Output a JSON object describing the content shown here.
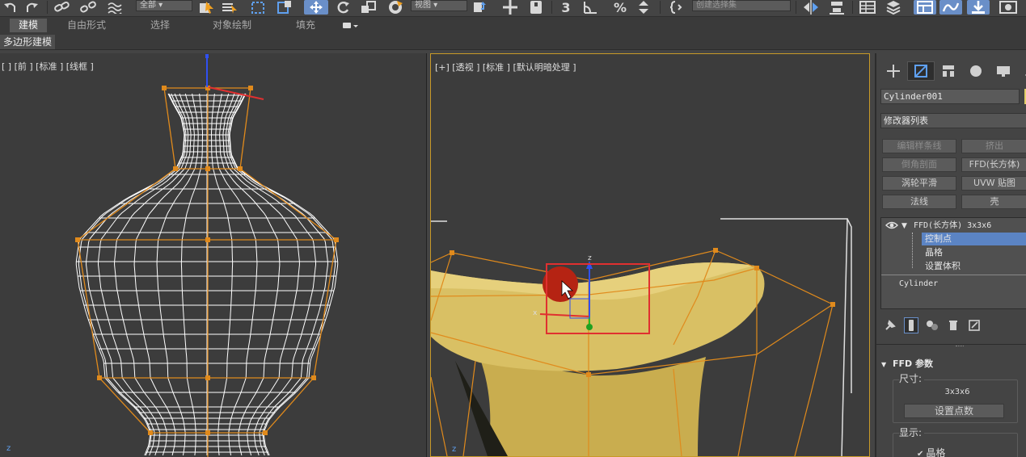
{
  "toolbar": {
    "filter_dropdown": "全部",
    "coord_dropdown": "视图",
    "selection_set_placeholder": "创建选择集",
    "icons": [
      "undo-icon",
      "redo-icon",
      "link-icon",
      "unlink-icon",
      "bind-space-warp-icon",
      "select-object-icon",
      "select-by-name-icon",
      "rect-region-icon",
      "window-crossing-icon",
      "move-icon",
      "rotate-icon",
      "scale-icon",
      "placement-icon",
      "pivot-icon",
      "snap-3d-icon",
      "angle-snap-icon",
      "percent-snap-icon",
      "spinner-snap-icon",
      "edit-named-selection-icon",
      "mirror-icon",
      "align-icon",
      "layer-explorer-icon",
      "toggle-ribbon-icon",
      "graph-editor-icon",
      "material-editor-icon",
      "render-setup-icon",
      "render-frame-icon"
    ]
  },
  "ribbon": {
    "tabs": [
      "建模",
      "自由形式",
      "选择",
      "对象绘制",
      "填充"
    ],
    "active_tab": "建模",
    "sub_tab": "多边形建模"
  },
  "viewports": {
    "left_label": "[ ] [前 ] [标准 ] [线框 ]",
    "right_label": "[+] [透视 ] [标准 ] [默认明暗处理 ]",
    "axis_z": "z",
    "axis_x": "x"
  },
  "command_panel": {
    "tab_icons": [
      "create-icon",
      "modify-icon",
      "hierarchy-icon",
      "motion-icon",
      "display-icon",
      "utilities-icon"
    ],
    "object_name": "Cylinder001",
    "modifier_list": "修改器列表",
    "modifier_buttons": [
      {
        "label": "编辑样条线",
        "enabled": false
      },
      {
        "label": "挤出",
        "enabled": false
      },
      {
        "label": "倒角剖面",
        "enabled": false
      },
      {
        "label": "FFD(长方体)",
        "enabled": true
      },
      {
        "label": "涡轮平滑",
        "enabled": true
      },
      {
        "label": "UVW 贴图",
        "enabled": true
      },
      {
        "label": "法线",
        "enabled": true
      },
      {
        "label": "壳",
        "enabled": true
      }
    ],
    "stack": {
      "modifier": "FFD(长方体) 3x3x6",
      "sub_items": [
        "控制点",
        "晶格",
        "设置体积"
      ],
      "selected_sub": "控制点",
      "base": "Cylinder"
    },
    "stack_tools": [
      "pin-stack-icon",
      "show-end-result-icon",
      "make-unique-icon",
      "remove-modifier-icon",
      "configure-modifier-sets-icon"
    ],
    "rollout": {
      "title": "FFD 参数",
      "size_label": "尺寸:",
      "dimensions": "3x3x6",
      "set_points_button": "设置点数",
      "display_label": "显示:",
      "lattice_checkbox": "晶格",
      "lattice_checked": true
    }
  },
  "colors": {
    "lattice": "#e08a1c",
    "wire": "#ffffff",
    "vase": "#d9c064",
    "selection": "#e03030",
    "viewport_bg": "#3c3c3c",
    "active_border": "#c89a28",
    "highlight": "#5b84c4"
  }
}
